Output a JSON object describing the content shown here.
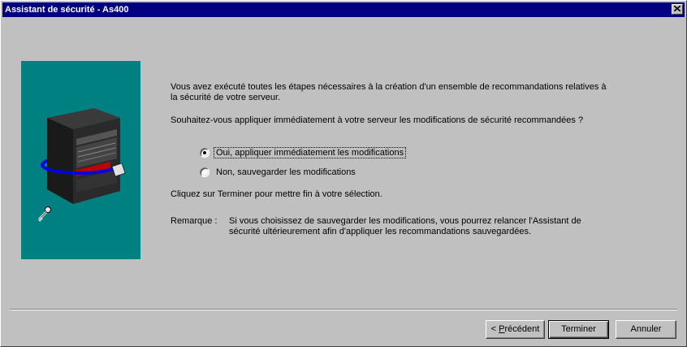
{
  "window": {
    "title": "Assistant de sécurité - As400"
  },
  "main": {
    "intro": "Vous avez exécuté toutes les étapes nécessaires à la création d'un ensemble de recommandations relatives à la sécurité de votre serveur.",
    "question": "Souhaitez-vous appliquer immédiatement à votre serveur les modifications de sécurité recommandées ?",
    "options": [
      {
        "label": "Oui, appliquer immédiatement les modifications",
        "checked": true
      },
      {
        "label": "Non, sauvegarder les modifications",
        "checked": false
      }
    ],
    "finish_hint": "Cliquez sur Terminer pour mettre fin à votre sélection.",
    "remark_label": "Remarque :",
    "remark_text": "Si vous choisissez de sauvegarder les modifications, vous pourrez relancer l'Assistant de sécurité ultérieurement afin d'appliquer les recommandations sauvegardées."
  },
  "buttons": {
    "previous_prefix": "< ",
    "previous_mnemonic": "P",
    "previous_rest": "récédent",
    "finish": "Terminer",
    "cancel": "Annuler"
  },
  "icons": {
    "close": "close-icon",
    "illustration": "server-illustration",
    "key": "key-icon"
  },
  "colors": {
    "titlebar": "#000080",
    "panel": "#008080",
    "face": "#c0c0c0"
  }
}
